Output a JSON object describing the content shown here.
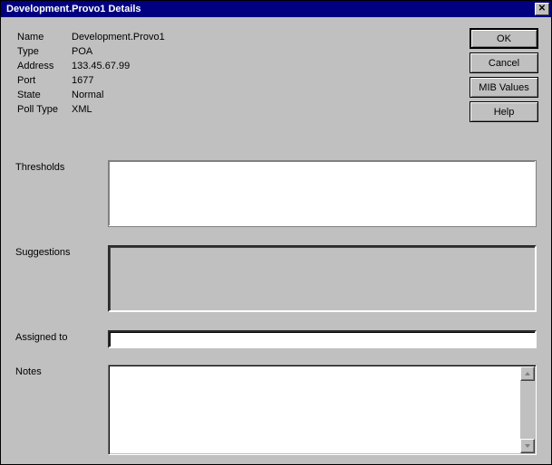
{
  "title": "Development.Provo1 Details",
  "info": {
    "name_label": "Name",
    "name_value": "Development.Provo1",
    "type_label": "Type",
    "type_value": "POA",
    "address_label": "Address",
    "address_value": "133.45.67.99",
    "port_label": "Port",
    "port_value": "1677",
    "state_label": "State",
    "state_value": "Normal",
    "polltype_label": "Poll Type",
    "polltype_value": "XML"
  },
  "buttons": {
    "ok": "OK",
    "cancel": "Cancel",
    "mib": "MIB Values",
    "help": "Help"
  },
  "fields": {
    "thresholds_label": "Thresholds",
    "thresholds_value": "",
    "suggestions_label": "Suggestions",
    "suggestions_value": "",
    "assigned_label": "Assigned to",
    "assigned_value": "",
    "notes_label": "Notes",
    "notes_value": ""
  }
}
